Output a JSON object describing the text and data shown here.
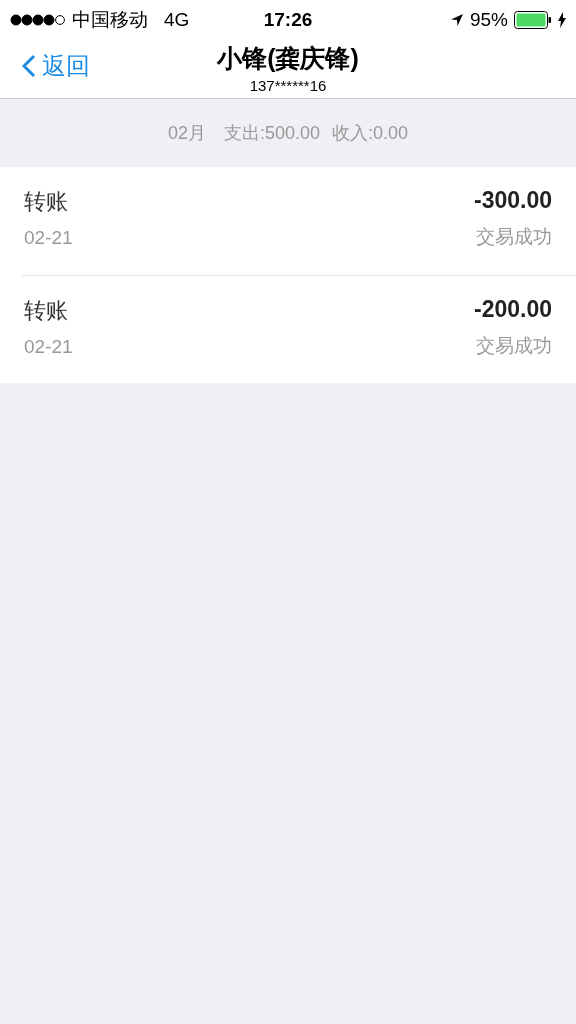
{
  "status_bar": {
    "carrier": "中国移动",
    "network": "4G",
    "time": "17:26",
    "battery": "95%"
  },
  "nav": {
    "back": "返回",
    "title": "小锋(龚庆锋)",
    "subtitle": "137******16"
  },
  "summary": {
    "month": "02月",
    "expense": "支出:500.00",
    "income": "收入:0.00"
  },
  "transactions": [
    {
      "type": "转账",
      "date": "02-21",
      "amount": "-300.00",
      "status": "交易成功"
    },
    {
      "type": "转账",
      "date": "02-21",
      "amount": "-200.00",
      "status": "交易成功"
    }
  ]
}
